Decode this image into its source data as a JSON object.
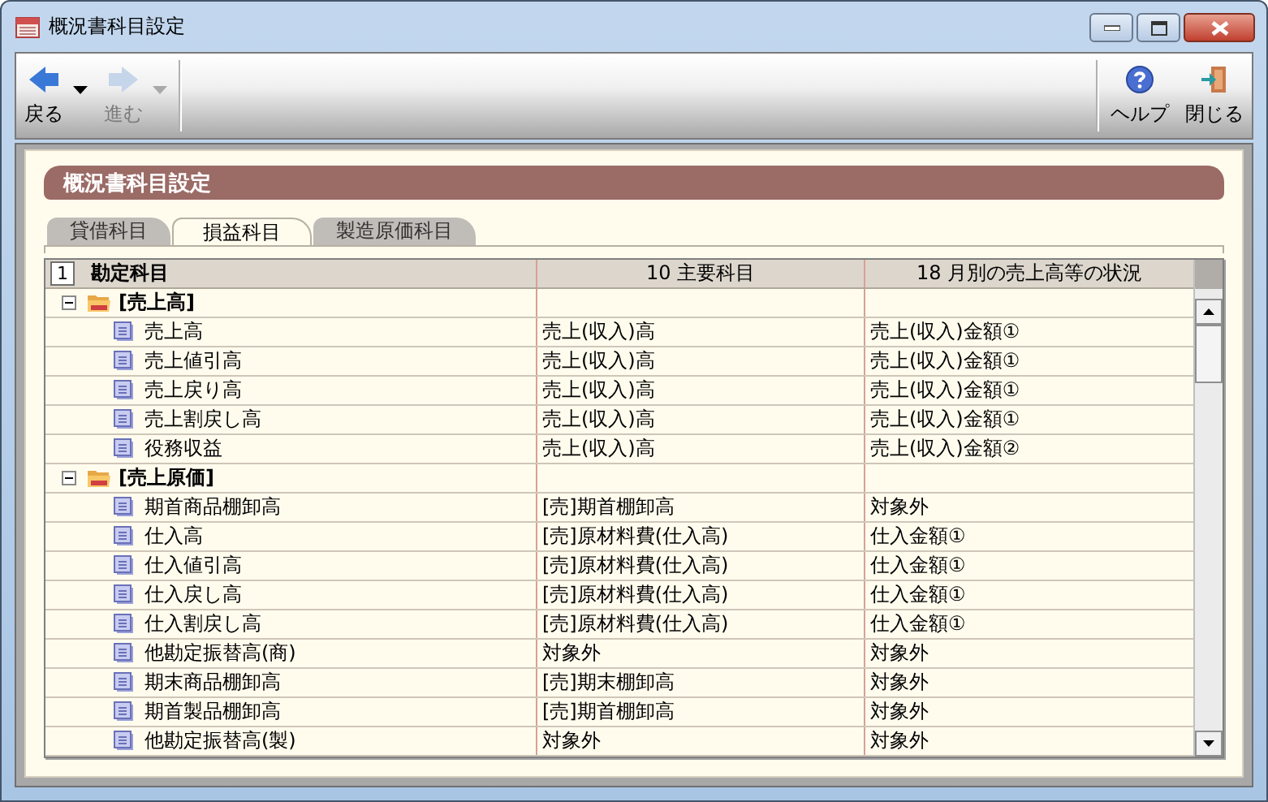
{
  "window": {
    "title": "概況書科目設定"
  },
  "toolbar": {
    "left": [
      {
        "label": "戻る",
        "kind": "back",
        "disabled": false
      },
      {
        "label": "進む",
        "kind": "forward",
        "disabled": true
      }
    ],
    "right": [
      {
        "label": "ヘルプ",
        "kind": "help"
      },
      {
        "label": "閉じる",
        "kind": "close"
      }
    ]
  },
  "section_title": "概況書科目設定",
  "tabs": [
    {
      "label": "貸借科目",
      "selected": false
    },
    {
      "label": "損益科目",
      "selected": true
    },
    {
      "label": "製造原価科目",
      "selected": false
    }
  ],
  "table": {
    "columns": [
      {
        "number": "1",
        "label": "勘定科目"
      },
      {
        "label": "10 主要科目"
      },
      {
        "label": "18 月別の売上高等の状況"
      }
    ],
    "rows": [
      {
        "label": "[売上高]",
        "expanded": true,
        "children": [
          {
            "label": "売上高",
            "column_2": "売上(収入)高",
            "column_3": "売上(収入)金額①"
          },
          {
            "label": "売上値引高",
            "column_2": "売上(収入)高",
            "column_3": "売上(収入)金額①"
          },
          {
            "label": "売上戻り高",
            "column_2": "売上(収入)高",
            "column_3": "売上(収入)金額①"
          },
          {
            "label": "売上割戻し高",
            "column_2": "売上(収入)高",
            "column_3": "売上(収入)金額①"
          },
          {
            "label": "役務収益",
            "column_2": "売上(収入)高",
            "column_3": "売上(収入)金額②"
          }
        ]
      },
      {
        "label": "[売上原価]",
        "expanded": true,
        "children": [
          {
            "label": "期首商品棚卸高",
            "column_2": "[売]期首棚卸高",
            "column_3": "対象外"
          },
          {
            "label": "仕入高",
            "column_2": "[売]原材料費(仕入高)",
            "column_3": "仕入金額①"
          },
          {
            "label": "仕入値引高",
            "column_2": "[売]原材料費(仕入高)",
            "column_3": "仕入金額①"
          },
          {
            "label": "仕入戻し高",
            "column_2": "[売]原材料費(仕入高)",
            "column_3": "仕入金額①"
          },
          {
            "label": "仕入割戻し高",
            "column_2": "[売]原材料費(仕入高)",
            "column_3": "仕入金額①"
          },
          {
            "label": "他勘定振替高(商)",
            "column_2": "対象外",
            "column_3": "対象外"
          },
          {
            "label": "期末商品棚卸高",
            "column_2": "[売]期末棚卸高",
            "column_3": "対象外"
          },
          {
            "label": "期首製品棚卸高",
            "column_2": "[売]期首棚卸高",
            "column_3": "対象外"
          },
          {
            "label": "他勘定振替高(製)",
            "column_2": "対象外",
            "column_3": "対象外"
          }
        ]
      }
    ]
  }
}
